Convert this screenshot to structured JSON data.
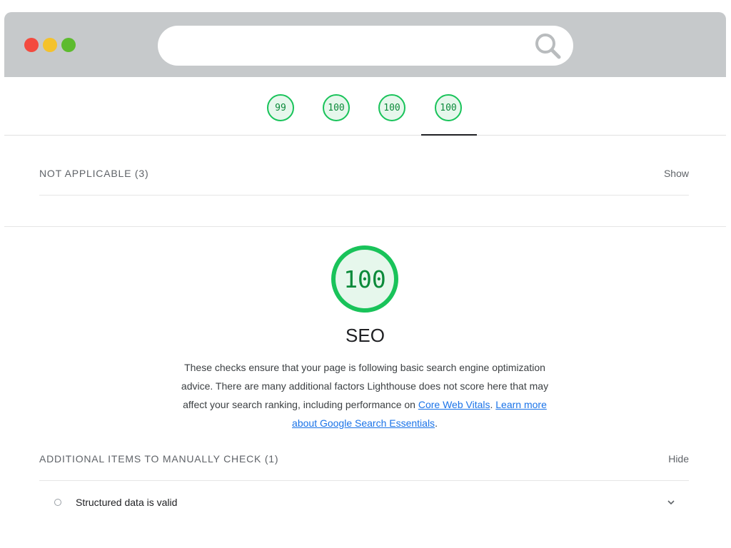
{
  "window": {
    "controls": [
      "close",
      "minimize",
      "zoom"
    ],
    "url_value": "",
    "search_icon": "search-icon"
  },
  "gauge_strip": {
    "scores": [
      {
        "category": "performance",
        "score": "99"
      },
      {
        "category": "accessibility",
        "score": "100"
      },
      {
        "category": "best-practices",
        "score": "100"
      },
      {
        "category": "seo",
        "score": "100"
      }
    ],
    "active_index": 3
  },
  "not_applicable": {
    "title": "NOT APPLICABLE (3)",
    "toggle_label": "Show"
  },
  "seo": {
    "score": "100",
    "title": "SEO",
    "description_text": "These checks ensure that your page is following basic search engine optimization advice. There are many additional factors Lighthouse does not score here that may affect your search ranking, including performance on ",
    "link_core_web_vitals": "Core Web Vitals",
    "separator": ". ",
    "link_learn_more": "Learn more about Google Search Essentials",
    "description_end": "."
  },
  "manual_check": {
    "title": "ADDITIONAL ITEMS TO MANUALLY CHECK (1)",
    "toggle_label": "Hide",
    "items": [
      {
        "title": "Structured data is valid",
        "icon": "chevron-down-icon"
      }
    ]
  },
  "colors": {
    "pass_green": "#19c35a",
    "pass_text": "#0b8a3a",
    "link_blue": "#1a73e8",
    "titlebar": "#c6c9cb"
  }
}
